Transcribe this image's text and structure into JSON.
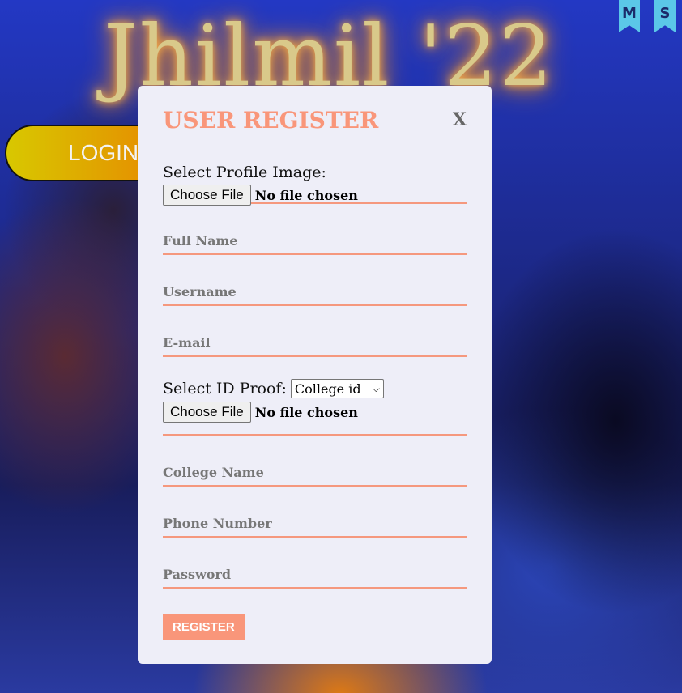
{
  "background": {
    "title": "Jhilmil '22",
    "login_label": "LOGIN",
    "flags": [
      "M",
      "S"
    ]
  },
  "modal": {
    "title": "USER REGISTER",
    "close_label": "X",
    "profile_image": {
      "label": "Select Profile Image:",
      "button_label": "Choose File",
      "status": "No file chosen"
    },
    "fields": {
      "full_name": "Full Name",
      "username": "Username",
      "email": "E-mail",
      "college_name": "College Name",
      "phone": "Phone Number",
      "password": "Password"
    },
    "id_proof": {
      "label": "Select ID Proof:",
      "selected": "College id",
      "button_label": "Choose File",
      "status": "No file chosen"
    },
    "register_label": "REGISTER"
  },
  "colors": {
    "accent": "#f9967a",
    "modal_bg": "#eeeef8"
  }
}
